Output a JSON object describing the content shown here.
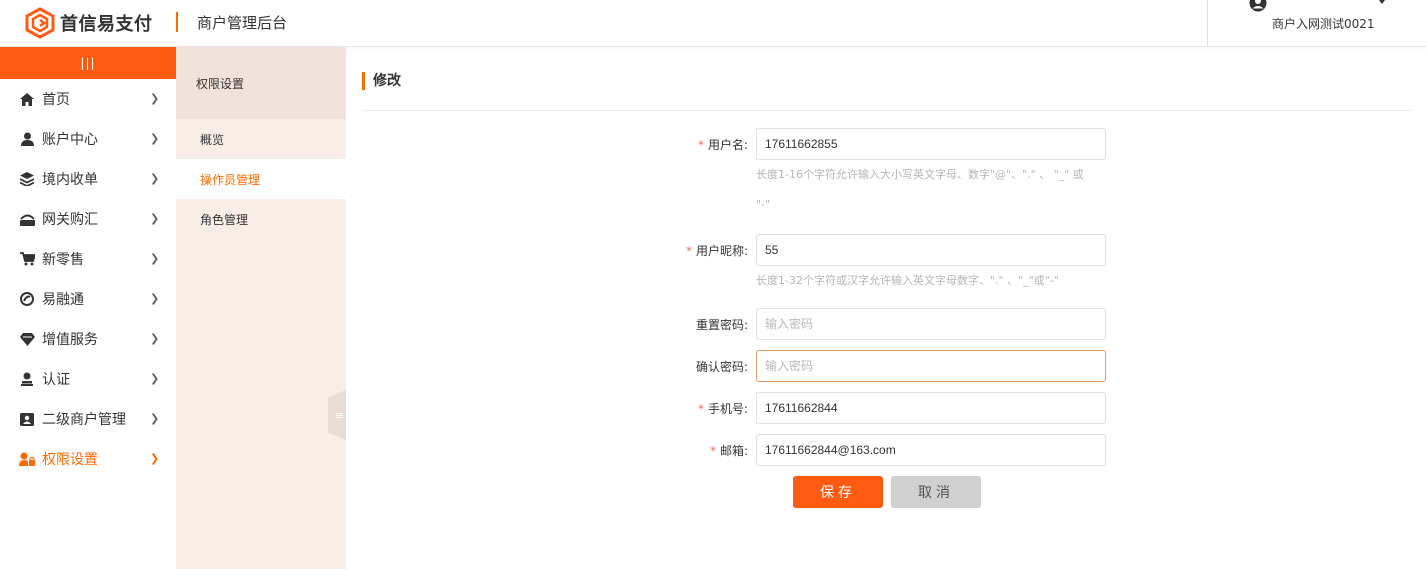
{
  "brand": {
    "name": "首信易支付",
    "accent": "#ff5a12"
  },
  "header": {
    "title": "商户管理后台",
    "user": "商户入网测试0021"
  },
  "nav": {
    "toggle": "|||",
    "items": [
      {
        "label": "首页",
        "icon": "home-icon"
      },
      {
        "label": "账户中心",
        "icon": "user-icon"
      },
      {
        "label": "境内收单",
        "icon": "layers-icon"
      },
      {
        "label": "网关购汇",
        "icon": "exchange-icon"
      },
      {
        "label": "新零售",
        "icon": "cart-icon"
      },
      {
        "label": "易融通",
        "icon": "finance-icon"
      },
      {
        "label": "增值服务",
        "icon": "diamond-icon"
      },
      {
        "label": "认证",
        "icon": "person-icon"
      },
      {
        "label": "二级商户管理",
        "icon": "id-card-icon"
      },
      {
        "label": "权限设置",
        "icon": "lock-person-icon",
        "active": true
      }
    ]
  },
  "subnav": {
    "heading": "权限设置",
    "items": [
      {
        "label": "概览"
      },
      {
        "label": "操作员管理",
        "active": true
      },
      {
        "label": "角色管理"
      }
    ]
  },
  "page": {
    "title": "修改",
    "form": {
      "username": {
        "label": "用户名:",
        "value": "17611662855",
        "hint_line1": "长度1-16个字符允许输入大小写英文字母、数字\"@\"、\".\" 、 \"_\" 或",
        "hint_line2": "\"-\""
      },
      "nickname": {
        "label": "用户昵称:",
        "value": "55",
        "hint": "长度1-32个字符或汉字允许输入英文字母数字、\".\" 、\"_\"或\"-\""
      },
      "reset_password": {
        "label": "重置密码:",
        "placeholder": "输入密码"
      },
      "confirm_password": {
        "label": "确认密码:",
        "placeholder": "输入密码"
      },
      "phone": {
        "label": "手机号:",
        "value": "17611662844"
      },
      "email": {
        "label": "邮箱:",
        "value": "17611662844@163.com"
      }
    },
    "buttons": {
      "save": "保存",
      "cancel": "取消"
    }
  }
}
